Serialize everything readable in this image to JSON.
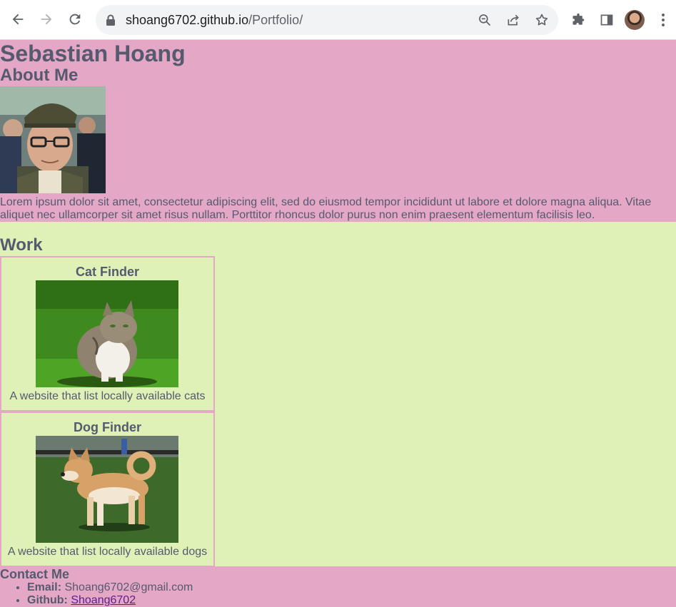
{
  "browser": {
    "url_host": "shoang6702.github.io",
    "url_path": "/Portfolio/"
  },
  "page": {
    "name": "Sebastian Hoang",
    "about": {
      "heading": "About Me",
      "text": "Lorem ipsum dolor sit amet, consectetur adipiscing elit, sed do eiusmod tempor incididunt ut labore et dolore magna aliqua. Vitae aliquet nec ullamcorper sit amet risus nullam. Porttitor rhoncus dolor purus non enim praesent elementum facilisis leo."
    },
    "work": {
      "heading": "Work",
      "projects": [
        {
          "title": "Cat Finder",
          "description": "A website that list locally available cats"
        },
        {
          "title": "Dog Finder",
          "description": "A website that list locally available dogs"
        }
      ]
    },
    "contact": {
      "heading": "Contact Me",
      "email_label": "Email:",
      "email_value": "Shoang6702@gmail.com",
      "github_label": "Github:",
      "github_value": "Shoang6702"
    }
  },
  "colors": {
    "pink": "#e4a7c6",
    "green": "#e0f1b7",
    "text": "#555a6e",
    "link": "#5b1f8a"
  }
}
